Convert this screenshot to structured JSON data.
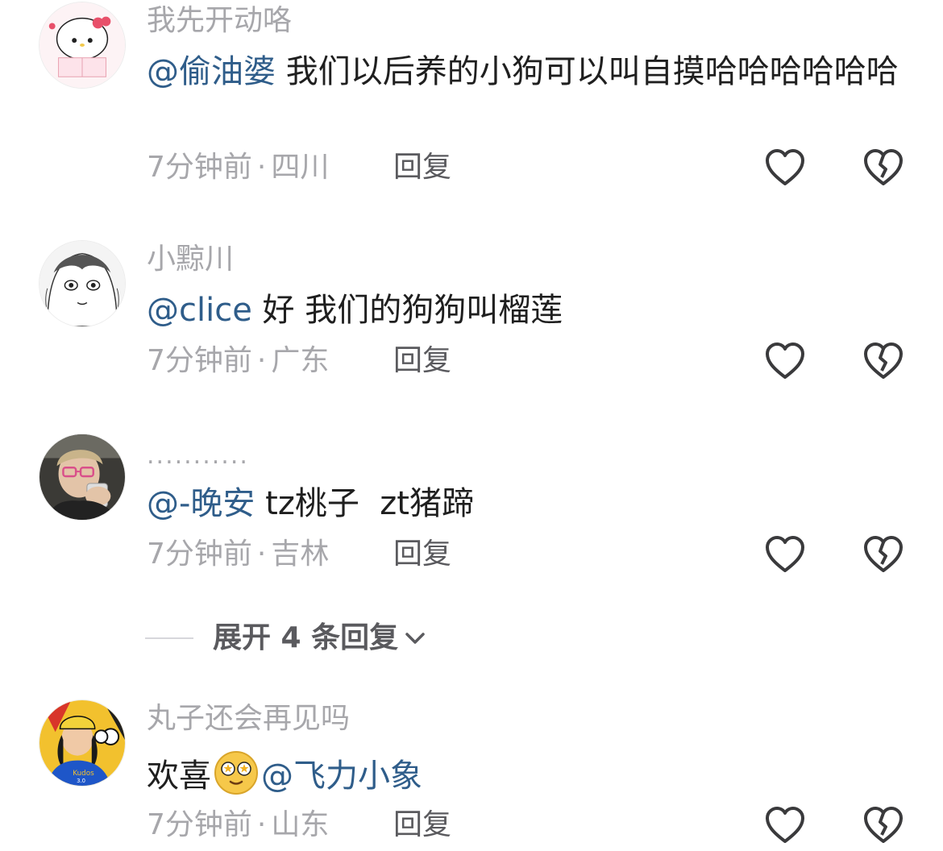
{
  "comments": [
    {
      "username": "我先开动咯",
      "mention": "@偷油婆",
      "text": " 我们以后养的小狗可以叫自摸哈哈哈哈哈哈",
      "time": "7分钟前",
      "dot": "·",
      "location": "四川",
      "reply": "回复"
    },
    {
      "username": "小黥川",
      "mention": "@clice",
      "text": " 好 我们的狗狗叫榴莲",
      "time": "7分钟前",
      "dot": "·",
      "location": "广东",
      "reply": "回复"
    },
    {
      "username": "...........",
      "mention": "@-晚安",
      "text": " tz桃子  zt猪蹄",
      "time": "7分钟前",
      "dot": "·",
      "location": "吉林",
      "reply": "回复"
    },
    {
      "username": "丸子还会再见吗",
      "text_before": "欢喜",
      "emoji": "star-eyes-emoji",
      "mention": "@飞力小象",
      "time": "7分钟前",
      "dot": "·",
      "location": "山东",
      "reply": "回复"
    }
  ],
  "expand_replies": {
    "label": "展开 4 条回复"
  },
  "colors": {
    "mention": "#2f5d8a",
    "secondary_text": "#a7a7ab",
    "primary_text": "#1f1f1f",
    "reply_text": "#5a5a5e"
  },
  "icons": {
    "like": "heart-outline-icon",
    "dislike": "broken-heart-outline-icon",
    "expand": "chevron-down-icon"
  }
}
